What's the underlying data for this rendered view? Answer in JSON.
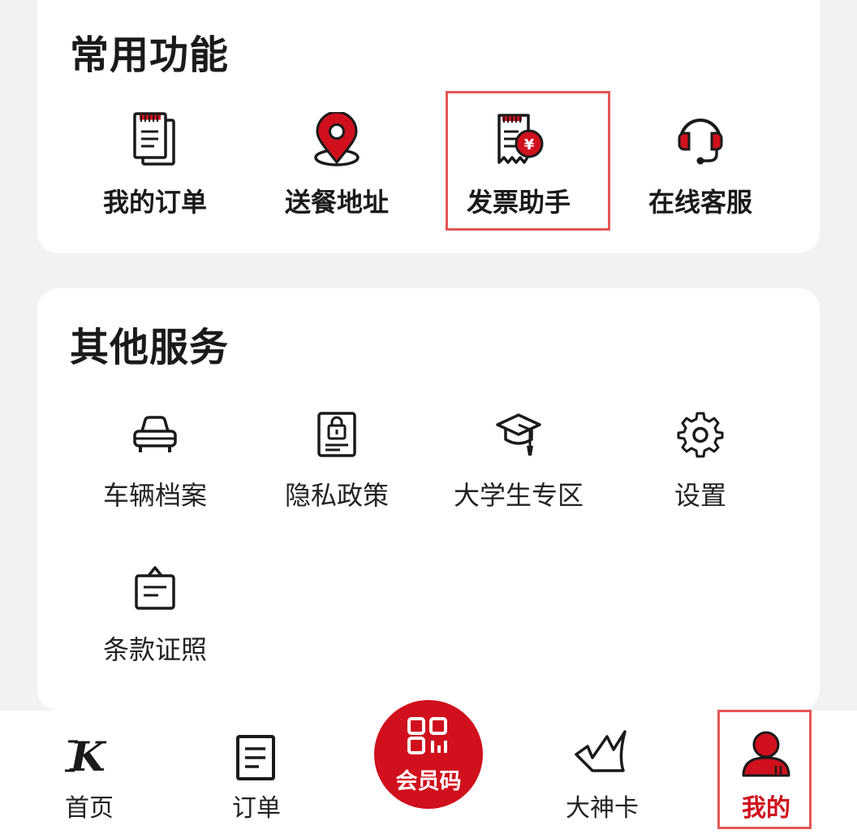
{
  "common": {
    "title": "常用功能",
    "items": [
      {
        "label": "我的订单",
        "icon": "orders-icon"
      },
      {
        "label": "送餐地址",
        "icon": "location-pin-icon"
      },
      {
        "label": "发票助手",
        "icon": "invoice-icon"
      },
      {
        "label": "在线客服",
        "icon": "headset-icon"
      }
    ]
  },
  "other": {
    "title": "其他服务",
    "items": [
      {
        "label": "车辆档案",
        "icon": "car-icon"
      },
      {
        "label": "隐私政策",
        "icon": "privacy-lock-icon"
      },
      {
        "label": "大学生专区",
        "icon": "graduation-cap-icon"
      },
      {
        "label": "设置",
        "icon": "gear-icon"
      },
      {
        "label": "条款证照",
        "icon": "license-icon"
      }
    ]
  },
  "tabbar": {
    "home": "首页",
    "orders": "订单",
    "member_code": "会员码",
    "card": "大神卡",
    "mine": "我的",
    "active": "mine"
  },
  "colors": {
    "brand_red": "#d0101d",
    "highlight": "#e45656"
  }
}
